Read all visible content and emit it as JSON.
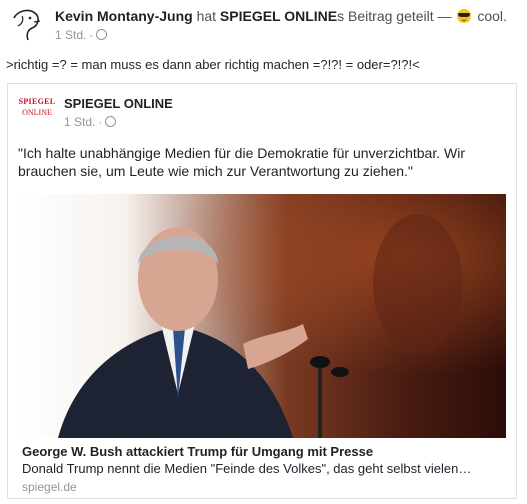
{
  "post": {
    "author": "Kevin Montany-Jung",
    "shared_prefix": "hat",
    "shared_page": "SPIEGEL ONLINE",
    "shared_suffix": "s Beitrag geteilt —",
    "feeling_icon": "sunglasses-emoji",
    "feeling": "cool.",
    "time": "1 Std.",
    "status_text": ">richtig =? =  man muss es dann aber richtig machen =?!?! = oder=?!?!<"
  },
  "shared": {
    "logo_line1": "SPIEGEL",
    "logo_line2": "ONLINE",
    "page_name": "SPIEGEL ONLINE",
    "time": "1 Std.",
    "quote": "\"Ich halte unabhängige Medien für die Demokratie für unverzichtbar. Wir brauchen sie, um Leute wie mich zur Verantwortung zu ziehen.\"",
    "link_title": "George W. Bush attackiert Trump für Umgang mit Presse",
    "link_description": "Donald Trump nennt die Medien \"Feinde des Volkes\", das geht selbst vielen…",
    "link_domain": "spiegel.de"
  },
  "colors": {
    "logo_red": "#c4161c",
    "meta_gray": "#90949c",
    "emoji_yellow": "#f7c325"
  }
}
